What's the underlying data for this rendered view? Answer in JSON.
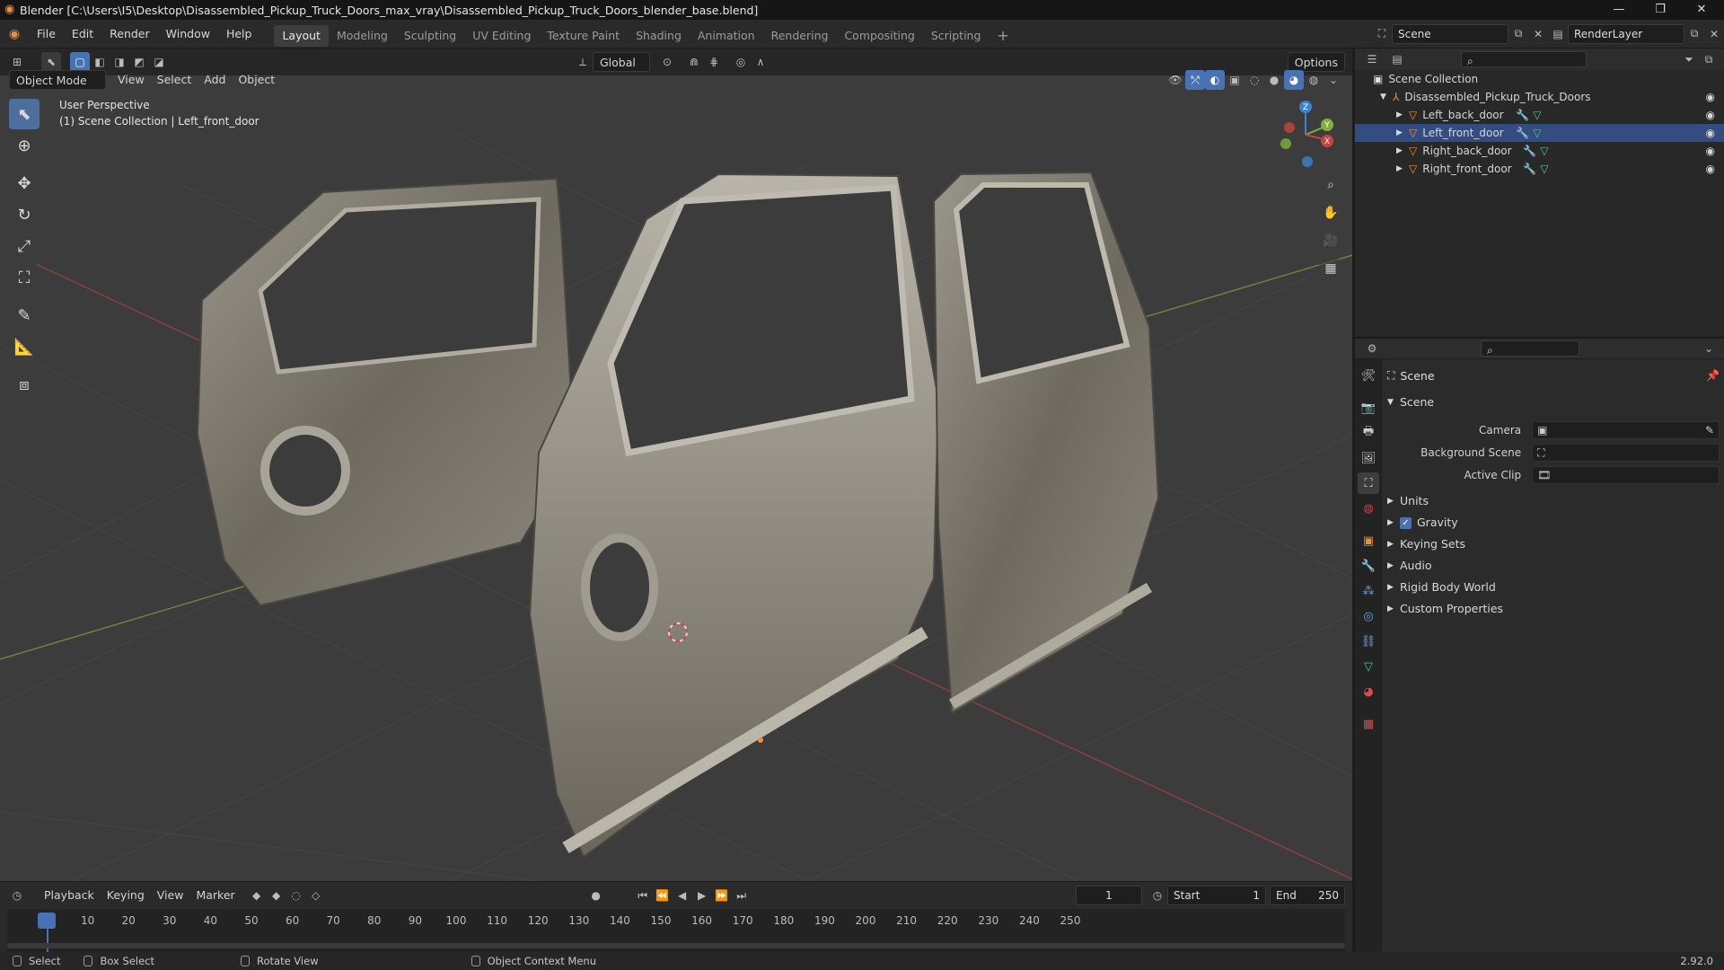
{
  "app": {
    "title": "Blender [C:\\Users\\I5\\Desktop\\Disassembled_Pickup_Truck_Doors_max_vray\\Disassembled_Pickup_Truck_Doors_blender_base.blend]",
    "version": "2.92.0",
    "icon": "blender-logo-icon"
  },
  "menu": [
    "File",
    "Edit",
    "Render",
    "Window",
    "Help"
  ],
  "workspaces": [
    "Layout",
    "Modeling",
    "Sculpting",
    "UV Editing",
    "Texture Paint",
    "Shading",
    "Animation",
    "Rendering",
    "Compositing",
    "Scripting"
  ],
  "active_workspace": "Layout",
  "scene_name": "Scene",
  "view_layer": "RenderLayer",
  "header": {
    "transform_orientation": "Global",
    "options_label": "Options"
  },
  "viewport_header": {
    "mode": "Object Mode",
    "menus": [
      "View",
      "Select",
      "Add",
      "Object"
    ]
  },
  "viewport": {
    "perspective_label": "User Perspective",
    "collection_label": "(1) Scene Collection | Left_front_door",
    "gizmo_axes": [
      "X",
      "Y",
      "Z"
    ]
  },
  "outliner": {
    "root": "Scene Collection",
    "collection": "Disassembled_Pickup_Truck_Doors",
    "objects": [
      "Left_back_door",
      "Left_front_door",
      "Right_back_door",
      "Right_front_door"
    ],
    "active_object": "Left_front_door"
  },
  "properties": {
    "context": "Scene",
    "panel": "Scene",
    "fields": [
      {
        "label": "Camera",
        "value": ""
      },
      {
        "label": "Background Scene",
        "value": ""
      },
      {
        "label": "Active Clip",
        "value": ""
      }
    ],
    "sections": [
      "Units",
      "Gravity",
      "Keying Sets",
      "Audio",
      "Rigid Body World",
      "Custom Properties"
    ],
    "gravity_enabled": true
  },
  "timeline": {
    "menus": [
      "Playback",
      "Keying",
      "View",
      "Marker"
    ],
    "current_frame": "1",
    "start_label": "Start",
    "start": "1",
    "end_label": "End",
    "end": "250",
    "ticks": [
      "1",
      "10",
      "20",
      "30",
      "40",
      "50",
      "60",
      "70",
      "80",
      "90",
      "100",
      "110",
      "120",
      "130",
      "140",
      "150",
      "160",
      "170",
      "180",
      "190",
      "200",
      "210",
      "220",
      "230",
      "240",
      "250"
    ]
  },
  "statusbar": {
    "items": [
      "Select",
      "Box Select",
      "Rotate View",
      "Object Context Menu"
    ]
  },
  "colors": {
    "accent": "#4772b3",
    "viewport_bg": "#3c3c3c",
    "x_axis": "#c8433f",
    "y_axis": "#7fb13a",
    "z_axis": "#3c84cf",
    "object_orange": "#e8933c"
  }
}
